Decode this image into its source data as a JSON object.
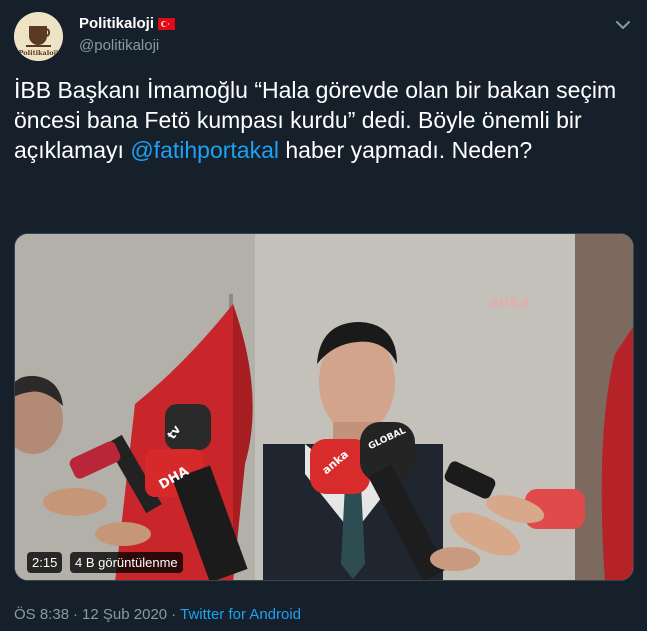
{
  "author": {
    "display_name": "Politikaloji",
    "handle": "@politikaloji",
    "avatar_text": "Politikaloji",
    "flag_icon": "turkey-flag-icon"
  },
  "tweet": {
    "text_before": "İBB Başkanı İmamoğlu “Hala görevde olan bir bakan seçim öncesi bana Fetö kumpası kurdu” dedi. Böyle önemli bir açıklamayı ",
    "mention": "@fatihportakal",
    "text_after": " haber yapmadı. Neden?"
  },
  "media": {
    "watermark": "anka",
    "duration": "2:15",
    "views": "4 B görüntülenme",
    "mic_labels": [
      "tv",
      "DHA",
      "GLOBAL",
      "anka"
    ]
  },
  "meta": {
    "time": "ÖS 8:38",
    "separator1": "·",
    "date": "12 Şub 2020",
    "separator2": "·",
    "source": "Twitter for Android"
  },
  "colors": {
    "background": "#15202b",
    "text": "#ffffff",
    "secondary": "#8899a6",
    "link": "#1da1f2"
  }
}
